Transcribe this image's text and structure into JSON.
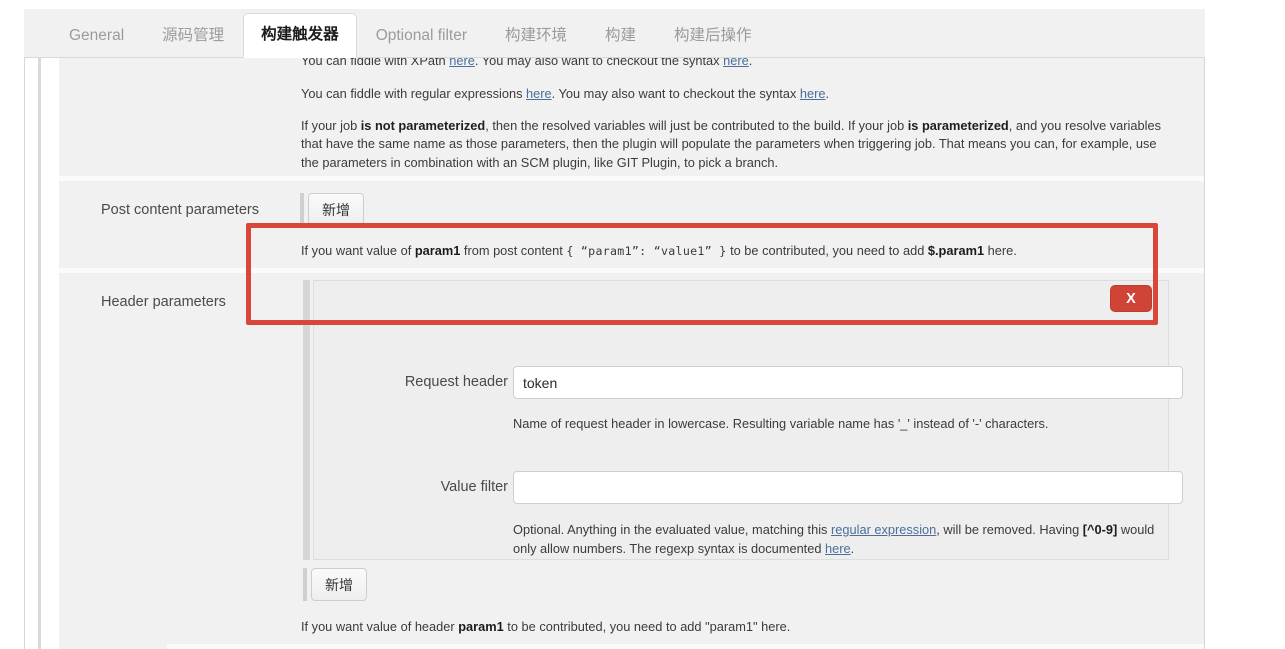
{
  "tabs": [
    {
      "label": "General",
      "active": false
    },
    {
      "label": "源码管理",
      "active": false
    },
    {
      "label": "构建触发器",
      "active": true
    },
    {
      "label": "Optional filter",
      "active": false
    },
    {
      "label": "构建环境",
      "active": false
    },
    {
      "label": "构建",
      "active": false
    },
    {
      "label": "构建后操作",
      "active": false
    }
  ],
  "intro": {
    "line1_a": "You can fiddle with XPath ",
    "line1_link1": "here",
    "line1_b": ". You may also want to checkout the syntax ",
    "line1_link2": "here",
    "line1_c": ".",
    "line2_a": "You can fiddle with regular expressions ",
    "line2_link1": "here",
    "line2_b": ". You may also want to checkout the syntax ",
    "line2_link2": "here",
    "line2_c": ".",
    "line3_a": "If your job ",
    "line3_b1": "is not parameterized",
    "line3_b": ", then the resolved variables will just be contributed to the build. If your job ",
    "line3_b2": "is parameterized",
    "line3_c": ", and you resolve variables that have the same name as those parameters, then the plugin will populate the parameters when triggering job. That means you can, for example, use the parameters in combination with an SCM plugin, like GIT Plugin, to pick a branch."
  },
  "post_content": {
    "label": "Post content parameters",
    "add_button": "新增",
    "hint_a": "If you want value of ",
    "hint_b1": "param1",
    "hint_b": " from post content ",
    "hint_mono": "{ “param1”: “value1” }",
    "hint_c": " to be contributed, you need to add ",
    "hint_b2": "$.param1",
    "hint_d": " here."
  },
  "header_params": {
    "label": "Header parameters",
    "delete_button": "X",
    "request_header": {
      "label": "Request header",
      "value": "token",
      "placeholder": "",
      "hint": "Name of request header in lowercase. Resulting variable name has '_' instead of '-' characters."
    },
    "value_filter": {
      "label": "Value filter",
      "value": "",
      "placeholder": "",
      "hint_a": "Optional. Anything in the evaluated value, matching this ",
      "hint_link1": "regular expression",
      "hint_b": ", will be removed. Having ",
      "hint_bold": "[^0-9]",
      "hint_c": " would only allow numbers. The regexp syntax is documented ",
      "hint_link2": "here",
      "hint_d": "."
    },
    "add_button": "新增",
    "bottom_hint_a": "If you want value of header ",
    "bottom_hint_b1": "param1",
    "bottom_hint_b": " to be contributed, you need to add \"param1\" here."
  },
  "colors": {
    "highlight_border": "#d9473b",
    "delete_button_bg": "#cf4436",
    "link": "#4b6e9b",
    "panel_bg": "#eeeeee",
    "form_bg": "#f1f1f1"
  }
}
